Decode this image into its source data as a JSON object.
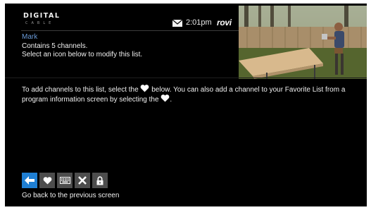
{
  "header": {
    "logo_main": "DIGITAL",
    "logo_sub": "CABLE",
    "time": "2:01pm",
    "brand": "rovi"
  },
  "list": {
    "name": "Mark",
    "channel_count_text": "Contains 5 channels.",
    "prompt": "Select an icon below to modify this list."
  },
  "instructions": {
    "part1": "To add channels to this list, select the",
    "part2": "below. You can also add a channel to your Favorite List from a program information screen by selecting the",
    "part3": "."
  },
  "toolbar": {
    "buttons": [
      {
        "name": "back",
        "icon": "back-arrow-icon",
        "selected": true
      },
      {
        "name": "favorite",
        "icon": "heart-icon",
        "selected": false
      },
      {
        "name": "rename",
        "icon": "keyboard-icon",
        "selected": false
      },
      {
        "name": "delete",
        "icon": "close-icon",
        "selected": false
      },
      {
        "name": "lock",
        "icon": "lock-icon",
        "selected": false
      }
    ]
  },
  "helper_text": "Go back to the previous screen",
  "colors": {
    "background": "#000000",
    "list_name": "#6a9bd8",
    "selected_button": "#1f7fd3",
    "button": "#4d4d4d"
  }
}
